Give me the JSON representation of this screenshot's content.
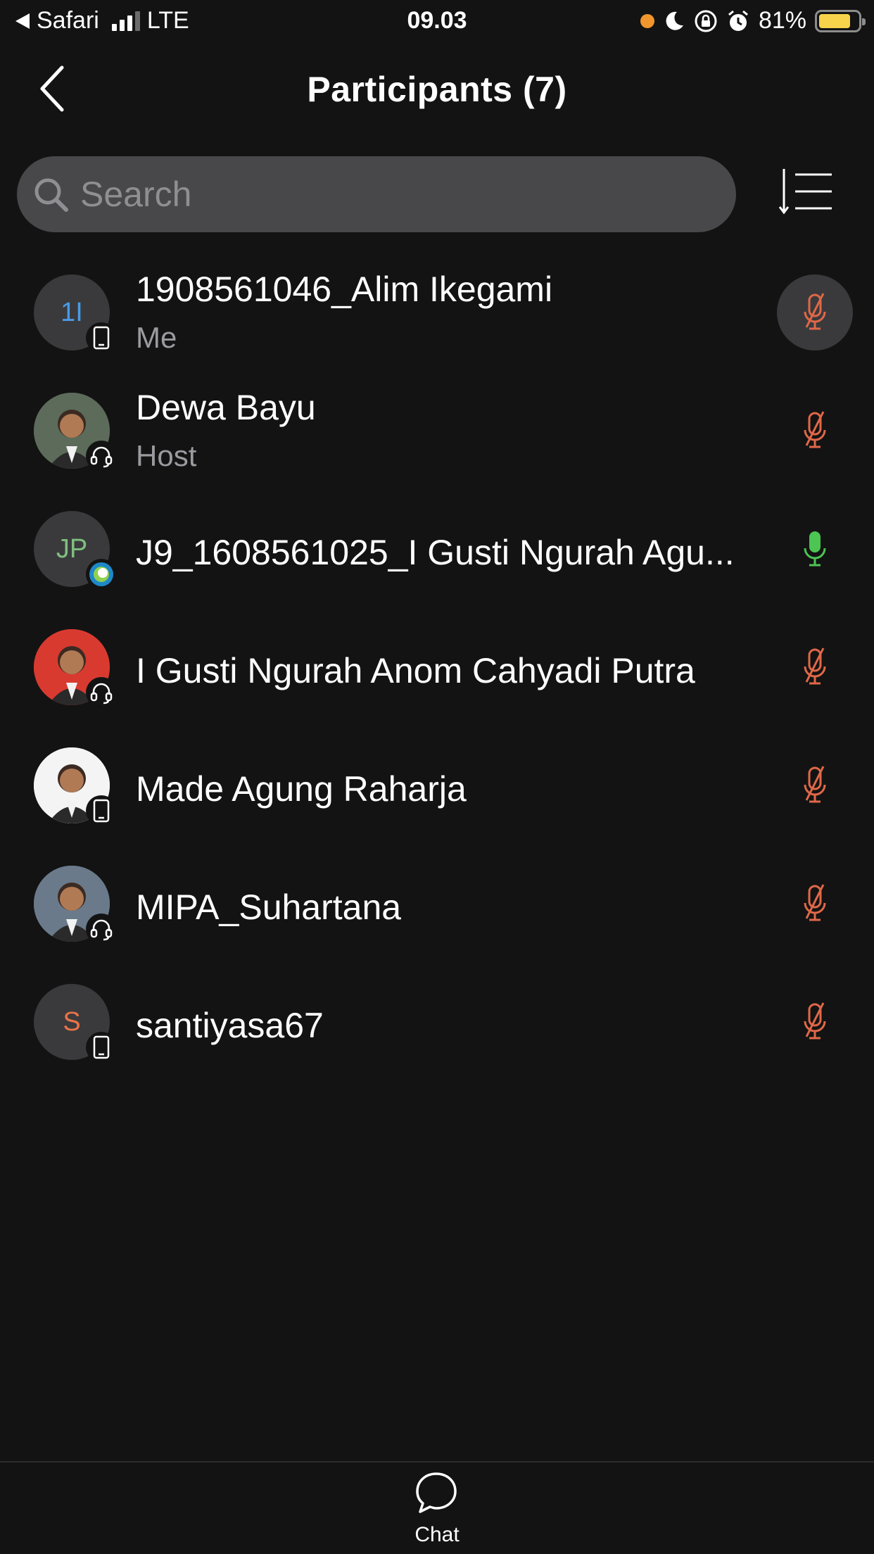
{
  "status_bar": {
    "back_app": "Safari",
    "network": "LTE",
    "time": "09.03",
    "battery_percent": "81%",
    "battery_level": 0.81,
    "icons": [
      "recording-dot-icon",
      "moon-icon",
      "rotation-lock-icon",
      "alarm-icon"
    ]
  },
  "header": {
    "title": "Participants (7)",
    "back_icon": "chevron-left-icon"
  },
  "search": {
    "placeholder": "Search",
    "value": ""
  },
  "sort_icon": "sort-list-icon",
  "participants": [
    {
      "name": "1908561046_Alim Ikegami",
      "subtitle": "Me",
      "initials": "1I",
      "initials_color": "#4a9be8",
      "avatar_bg": "#3a3a3c",
      "device": "phone-icon",
      "mic": "muted",
      "mic_highlighted": true
    },
    {
      "name": "Dewa Bayu",
      "subtitle": "Host",
      "initials": "",
      "avatar_bg": "#5c6b5a",
      "device": "headset-icon",
      "mic": "muted"
    },
    {
      "name": "J9_1608561025_I Gusti Ngurah Agu...",
      "subtitle": "",
      "initials": "JP",
      "initials_color": "#7fbf7f",
      "avatar_bg": "#3a3a3c",
      "device": "webex-icon",
      "mic": "active"
    },
    {
      "name": "I Gusti Ngurah Anom Cahyadi Putra",
      "subtitle": "",
      "initials": "",
      "avatar_bg": "#d83a30",
      "device": "headset-icon",
      "mic": "muted"
    },
    {
      "name": "Made Agung Raharja",
      "subtitle": "",
      "initials": "",
      "avatar_bg": "#f4f4f4",
      "device": "phone-icon",
      "mic": "muted"
    },
    {
      "name": "MIPA_Suhartana",
      "subtitle": "",
      "initials": "",
      "avatar_bg": "#6a7a8a",
      "device": "headset-icon",
      "mic": "muted"
    },
    {
      "name": "santiyasa67",
      "subtitle": "",
      "initials": "S",
      "initials_color": "#e8734a",
      "avatar_bg": "#3a3a3c",
      "device": "phone-icon",
      "mic": "muted"
    }
  ],
  "colors": {
    "muted_mic": "#e06848",
    "active_mic": "#4cc552",
    "background": "#131313"
  },
  "bottom_bar": {
    "chat_label": "Chat",
    "chat_icon": "chat-bubble-icon"
  }
}
